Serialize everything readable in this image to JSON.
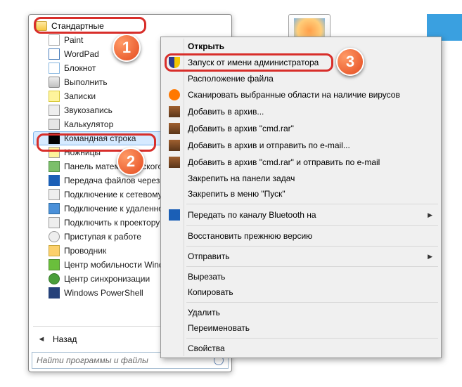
{
  "startmenu": {
    "folder": "Стандартные",
    "items": [
      {
        "label": "Paint",
        "iconClass": "paint"
      },
      {
        "label": "WordPad",
        "iconClass": "wordpad"
      },
      {
        "label": "Блокнот",
        "iconClass": "notepad"
      },
      {
        "label": "Выполнить",
        "iconClass": "run"
      },
      {
        "label": "Записки",
        "iconClass": "notes"
      },
      {
        "label": "Звукозапись",
        "iconClass": "sound"
      },
      {
        "label": "Калькулятор",
        "iconClass": "calc"
      },
      {
        "label": "Командная строка",
        "iconClass": "cmd"
      },
      {
        "label": "Ножницы",
        "iconClass": "clipboard"
      },
      {
        "label": "Панель математического ввода",
        "iconClass": "motherboard"
      },
      {
        "label": "Передача файлов через Bluetooth",
        "iconClass": "bt"
      },
      {
        "label": "Подключение к сетевому проектору",
        "iconClass": "net"
      },
      {
        "label": "Подключение к удаленному рабочему столу",
        "iconClass": "rdp"
      },
      {
        "label": "Подключить к проектору",
        "iconClass": "projector"
      },
      {
        "label": "Приступая к работе",
        "iconClass": "gear"
      },
      {
        "label": "Проводник",
        "iconClass": "explorer"
      },
      {
        "label": "Центр мобильности Windows",
        "iconClass": "green"
      },
      {
        "label": "Центр синхронизации",
        "iconClass": "sync"
      },
      {
        "label": "Windows PowerShell",
        "iconClass": "ps"
      }
    ],
    "back": "Назад",
    "search_placeholder": "Найти программы и файлы"
  },
  "context": {
    "open": "Открыть",
    "runas": "Запуск от имени администратора",
    "location": "Расположение файла",
    "scan": "Сканировать выбранные области на наличие вирусов",
    "archive": "Добавить в архив...",
    "archive_cmd": "Добавить в архив \"cmd.rar\"",
    "archive_email": "Добавить в архив и отправить по e-mail...",
    "archive_cmd_email": "Добавить в архив \"cmd.rar\" и отправить по e-mail",
    "pin_taskbar": "Закрепить на панели задач",
    "pin_start": "Закрепить в меню \"Пуск\"",
    "bt": "Передать по каналу Bluetooth на",
    "restore": "Восстановить прежнюю версию",
    "sendto": "Отправить",
    "cut": "Вырезать",
    "copy": "Копировать",
    "delete": "Удалить",
    "rename": "Переименовать",
    "props": "Свойства"
  },
  "badges": {
    "b1": "1",
    "b2": "2",
    "b3": "3"
  }
}
